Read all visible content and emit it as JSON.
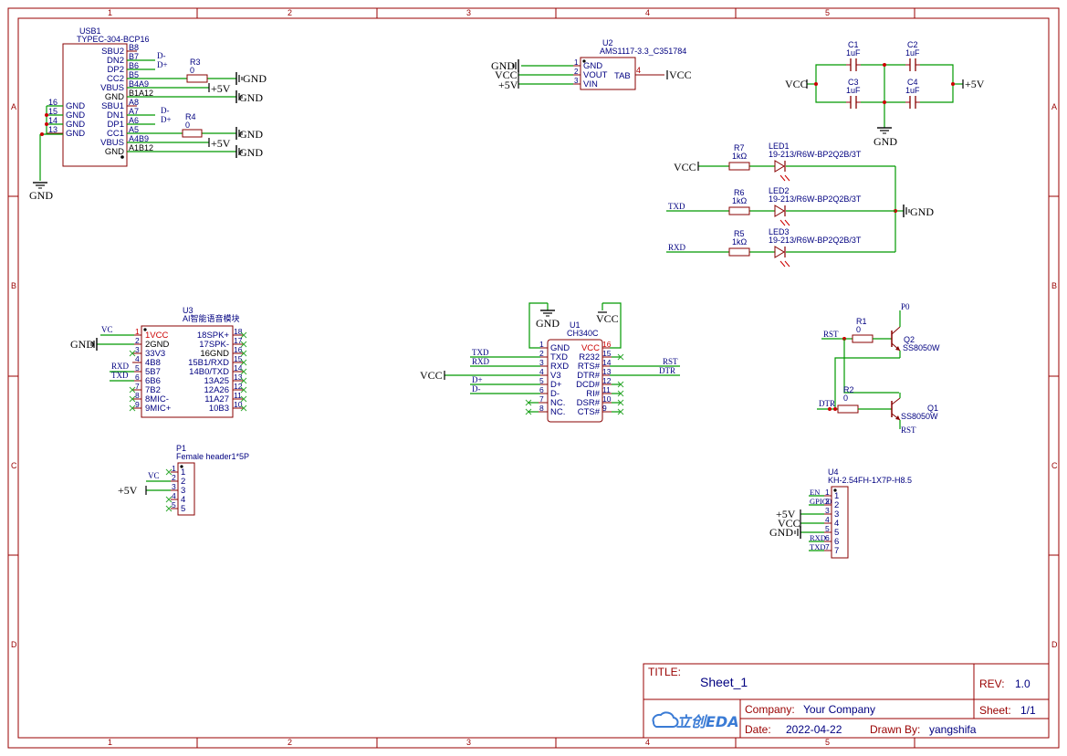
{
  "frame": {
    "columns": [
      "1",
      "2",
      "3",
      "4",
      "5"
    ],
    "rows": [
      "A",
      "B",
      "C",
      "D"
    ]
  },
  "title_block": {
    "title_label": "TITLE:",
    "title": "Sheet_1",
    "rev_label": "REV:",
    "rev": "1.0",
    "company_label": "Company:",
    "company": "Your Company",
    "sheet_label": "Sheet:",
    "sheet": "1/1",
    "date_label": "Date:",
    "date": "2022-04-22",
    "drawn_label": "Drawn By:",
    "drawn_by": "yangshifa",
    "logo_text": "立创EDA"
  },
  "power": {
    "gnd": "GND",
    "vcc": "VCC",
    "p5v": "+5V"
  },
  "usb1": {
    "ref": "USB1",
    "value": "TYPEC-304-BCP16",
    "right_pins": [
      {
        "name": "SBU2",
        "num": "B8"
      },
      {
        "name": "DN2",
        "num": "B7"
      },
      {
        "name": "DP2",
        "num": "B6"
      },
      {
        "name": "CC2",
        "num": "B5"
      },
      {
        "name": "VBUS",
        "num": "B4A9"
      },
      {
        "name": "GND",
        "num": "B1A12"
      },
      {
        "name": "SBU1",
        "num": "A8"
      },
      {
        "name": "DN1",
        "num": "A7"
      },
      {
        "name": "DP1",
        "num": "A6"
      },
      {
        "name": "CC1",
        "num": "A5"
      },
      {
        "name": "VBUS",
        "num": "A4B9"
      },
      {
        "name": "GND",
        "num": "A1B12"
      }
    ],
    "left_pins": [
      {
        "name": "GND",
        "num": "16"
      },
      {
        "name": "GND",
        "num": "15"
      },
      {
        "name": "GND",
        "num": "14"
      },
      {
        "name": "GND",
        "num": "13"
      }
    ],
    "nets": {
      "dminus": "D-",
      "dplus": "D+"
    }
  },
  "r3": {
    "ref": "R3",
    "value": "0"
  },
  "r4": {
    "ref": "R4",
    "value": "0"
  },
  "u2": {
    "ref": "U2",
    "value": "AMS1117-3.3_C351784",
    "pins": [
      {
        "num": "1",
        "name": "GND"
      },
      {
        "num": "2",
        "name": "VOUT"
      },
      {
        "num": "3",
        "name": "VIN"
      }
    ],
    "tab_num": "4",
    "tab_name": "TAB"
  },
  "caps": [
    {
      "ref": "C1",
      "value": "1uF"
    },
    {
      "ref": "C2",
      "value": "1uF"
    },
    {
      "ref": "C3",
      "value": "1uF"
    },
    {
      "ref": "C4",
      "value": "1uF"
    }
  ],
  "leds": [
    {
      "rref": "R7",
      "rval": "1kΩ",
      "lref": "LED1",
      "lval": "19-213/R6W-BP2Q2B/3T",
      "net": "VCC"
    },
    {
      "rref": "R6",
      "rval": "1kΩ",
      "lref": "LED2",
      "lval": "19-213/R6W-BP2Q2B/3T",
      "net": "TXD"
    },
    {
      "rref": "R5",
      "rval": "1kΩ",
      "lref": "LED3",
      "lval": "19-213/R6W-BP2Q2B/3T",
      "net": "RXD"
    }
  ],
  "u3": {
    "ref": "U3",
    "value": "AI智能语音模块",
    "left_pins": [
      {
        "num": "1",
        "name": "1VCC"
      },
      {
        "num": "2",
        "name": "2GND"
      },
      {
        "num": "3",
        "name": "33V3"
      },
      {
        "num": "4",
        "name": "4B8"
      },
      {
        "num": "5",
        "name": "5B7"
      },
      {
        "num": "6",
        "name": "6B6"
      },
      {
        "num": "7",
        "name": "7B2"
      },
      {
        "num": "8",
        "name": "8MIC-"
      },
      {
        "num": "9",
        "name": "9MIC+"
      }
    ],
    "right_pins": [
      {
        "num": "18",
        "name": "18SPK+"
      },
      {
        "num": "17",
        "name": "17SPK-"
      },
      {
        "num": "16",
        "name": "16GND"
      },
      {
        "num": "15",
        "name": "15B1/RXD"
      },
      {
        "num": "14",
        "name": "14B0/TXD"
      },
      {
        "num": "13",
        "name": "13A25"
      },
      {
        "num": "12",
        "name": "12A26"
      },
      {
        "num": "11",
        "name": "11A27"
      },
      {
        "num": "10",
        "name": "10B3"
      }
    ],
    "nets": {
      "vc": "VC",
      "rxd": "RXD",
      "txd": "TXD"
    }
  },
  "u1": {
    "ref": "U1",
    "value": "CH340C",
    "left_pins": [
      {
        "num": "1",
        "name": "GND"
      },
      {
        "num": "2",
        "name": "TXD"
      },
      {
        "num": "3",
        "name": "RXD"
      },
      {
        "num": "4",
        "name": "V3"
      },
      {
        "num": "5",
        "name": "D+"
      },
      {
        "num": "6",
        "name": "D-"
      },
      {
        "num": "7",
        "name": "NC."
      },
      {
        "num": "8",
        "name": "NC."
      }
    ],
    "right_pins": [
      {
        "num": "16",
        "name": "VCC"
      },
      {
        "num": "15",
        "name": "R232"
      },
      {
        "num": "14",
        "name": "RTS#"
      },
      {
        "num": "13",
        "name": "DTR#"
      },
      {
        "num": "12",
        "name": "DCD#"
      },
      {
        "num": "11",
        "name": "RI#"
      },
      {
        "num": "10",
        "name": "DSR#"
      },
      {
        "num": "9",
        "name": "CTS#"
      }
    ],
    "nets": {
      "txd": "TXD",
      "rxd": "RXD",
      "dplus": "D+",
      "dminus": "D-",
      "rst": "RST",
      "dtr": "DTR"
    }
  },
  "p1": {
    "ref": "P1",
    "value": "Female header1*5P",
    "pins": [
      "1",
      "2",
      "3",
      "4",
      "5"
    ],
    "net": "VC"
  },
  "q": {
    "r1": {
      "ref": "R1",
      "value": "0"
    },
    "r2": {
      "ref": "R2",
      "value": "0"
    },
    "q2": {
      "ref": "Q2",
      "value": "SS8050W"
    },
    "q1": {
      "ref": "Q1",
      "value": "SS8050W"
    },
    "nets": {
      "p0": "P0",
      "rst": "RST",
      "dtr": "DTR"
    }
  },
  "u4": {
    "ref": "U4",
    "value": "KH-2.54FH-1X7P-H8.5",
    "pins": [
      "1",
      "2",
      "3",
      "4",
      "5",
      "6",
      "7"
    ],
    "nets": [
      "EN",
      "GPIO0",
      "",
      "",
      "",
      "RXD",
      "TXD"
    ]
  }
}
